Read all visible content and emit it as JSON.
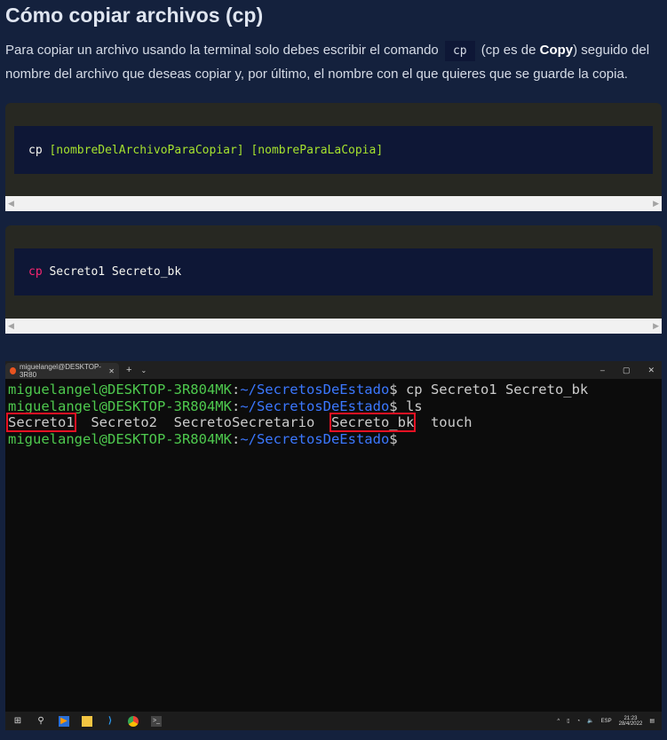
{
  "heading": "Cómo copiar archivos (cp)",
  "paragraph": {
    "before": "Para copiar un archivo usando la terminal solo debes escribir el comando",
    "code": "cp",
    "middle": "(cp es de ",
    "bold": "Copy",
    "after": ") seguido del nombre del archivo que deseas copiar y, por último, el nombre con el que quieres que se guarde la copia."
  },
  "code_blocks": [
    {
      "cmd": "cp",
      "args": "[nombreDelArchivoParaCopiar] [nombreParaLaCopia]"
    },
    {
      "cmd": "cp",
      "args": "Secreto1 Secreto_bk"
    }
  ],
  "terminal": {
    "tab_title": "miguelangel@DESKTOP-3R80",
    "user_host": "miguelangel@DESKTOP-3R804MK",
    "path": "~/SecretosDeEstado",
    "cmd1": "cp Secreto1 Secreto_bk",
    "cmd2": "ls",
    "files": [
      "Secreto1",
      "Secreto2",
      "SecretoSecretario",
      "Secreto_bk",
      "touch"
    ],
    "highlighted_files": [
      "Secreto1",
      "Secreto_bk"
    ],
    "highlight_color": "#e81123"
  },
  "taskbar": {
    "lang": "ESP",
    "time": "21:23",
    "date": "28/4/2022"
  },
  "colors": {
    "bg": "#14213d",
    "code_outer": "#272822",
    "code_inner": "#0e1736",
    "keyword": "#f92672",
    "arg": "#a6e22e"
  }
}
